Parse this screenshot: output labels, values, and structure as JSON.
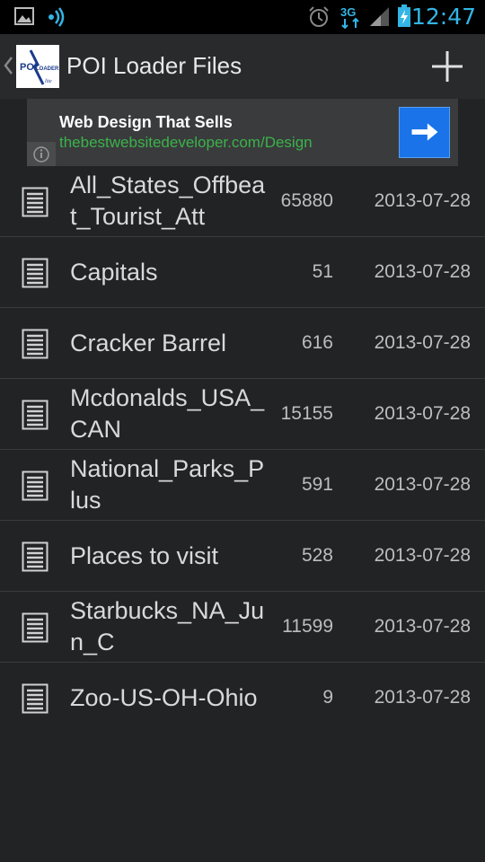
{
  "status_bar": {
    "time": "12:47",
    "network": "3G",
    "icons": [
      "gallery-icon",
      "radio-icon",
      "alarm-icon",
      "3g-icon",
      "signal-icon",
      "battery-icon"
    ]
  },
  "action_bar": {
    "title": "POI Loader Files",
    "logo_text": "POI LOADER lite",
    "add_icon": "plus-icon"
  },
  "ad": {
    "headline": "Web Design That Sells",
    "url": "thebestwebsitedeveloper.com/Design",
    "info_icon": "info-icon",
    "go_icon": "arrow-right-icon"
  },
  "files": [
    {
      "name": "All_States_Offbeat_Tourist_Att",
      "count": "65880",
      "date": "2013-07-28"
    },
    {
      "name": "Capitals",
      "count": "51",
      "date": "2013-07-28"
    },
    {
      "name": "Cracker Barrel",
      "count": "616",
      "date": "2013-07-28"
    },
    {
      "name": "Mcdonalds_USA_CAN",
      "count": "15155",
      "date": "2013-07-28"
    },
    {
      "name": "National_Parks_Plus",
      "count": "591",
      "date": "2013-07-28"
    },
    {
      "name": "Places to visit",
      "count": "528",
      "date": "2013-07-28"
    },
    {
      "name": "Starbucks_NA_Jun_C",
      "count": "11599",
      "date": "2013-07-28"
    },
    {
      "name": "Zoo-US-OH-Ohio",
      "count": "9",
      "date": "2013-07-28"
    }
  ],
  "colors": {
    "accent": "#33b5e5",
    "ad_url": "#3ab34a",
    "ad_button": "#1a73e8",
    "background": "#222325"
  }
}
